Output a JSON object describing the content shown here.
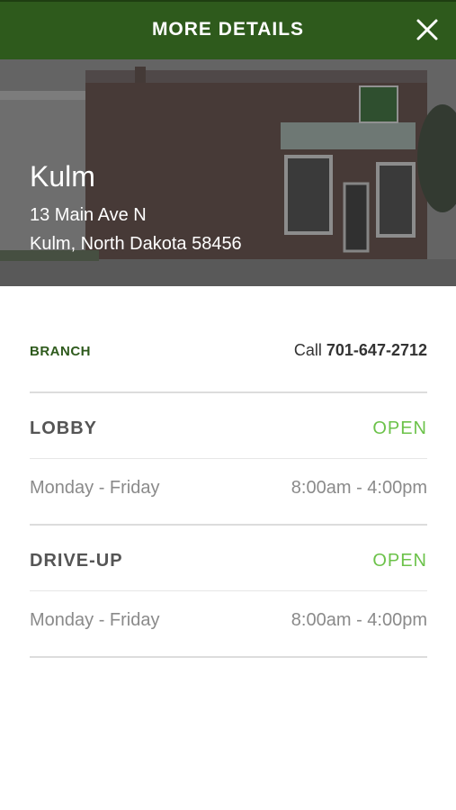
{
  "header": {
    "title": "MORE DETAILS",
    "close_icon": "close-icon"
  },
  "location": {
    "city": "Kulm",
    "address_line1": "13 Main Ave N",
    "address_line2": "Kulm, North Dakota 58456"
  },
  "branch": {
    "label": "BRANCH",
    "call_prefix": "Call",
    "phone": "701-647-2712"
  },
  "lobby": {
    "title": "LOBBY",
    "status": "OPEN",
    "days": "Monday - Friday",
    "hours": "8:00am - 4:00pm"
  },
  "drive_up": {
    "title": "DRIVE-UP",
    "status": "OPEN",
    "days": "Monday - Friday",
    "hours": "8:00am - 4:00pm"
  },
  "colors": {
    "header_green": "#2e5a1c",
    "open_green": "#6cc24a"
  }
}
